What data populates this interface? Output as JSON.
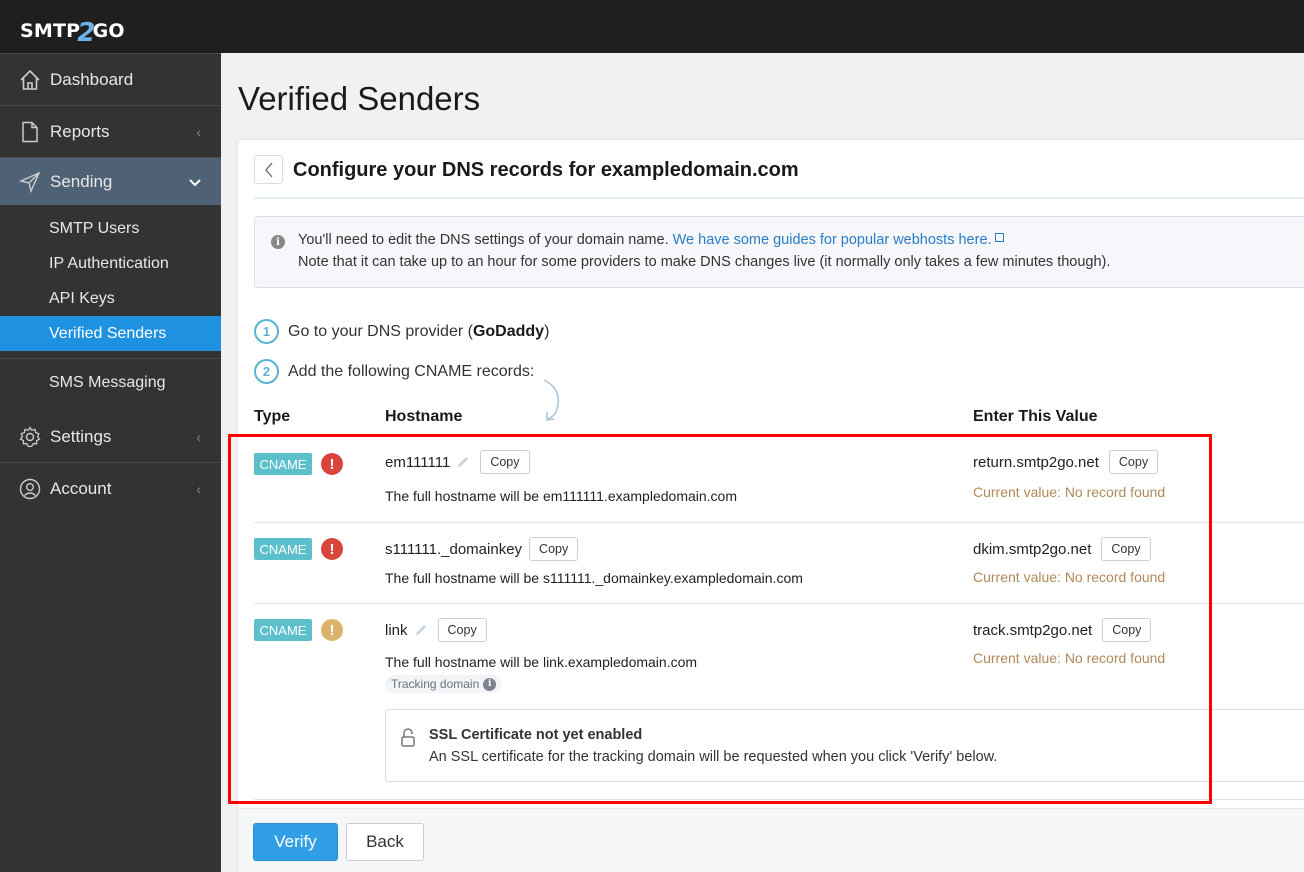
{
  "app": {
    "logo_left": "SMTP",
    "logo_mid": "2",
    "logo_right": "GO"
  },
  "sidebar": {
    "items": [
      {
        "label": "Dashboard",
        "icon": "home-icon"
      },
      {
        "label": "Reports",
        "icon": "file-icon",
        "chevron": "‹"
      },
      {
        "label": "Sending",
        "icon": "paper-plane-icon",
        "chevron": "⌄",
        "active": true
      }
    ],
    "sub_items": [
      {
        "label": "SMTP Users"
      },
      {
        "label": "IP Authentication"
      },
      {
        "label": "API Keys"
      },
      {
        "label": "Verified Senders",
        "selected": true
      },
      {
        "label": "SMS Messaging"
      }
    ],
    "bottom_items": [
      {
        "label": "Settings",
        "icon": "gear-icon",
        "chevron": "‹"
      },
      {
        "label": "Account",
        "icon": "user-circle-icon",
        "chevron": "‹"
      }
    ]
  },
  "page": {
    "title": "Verified Senders",
    "card_title": "Configure your DNS records for exampledomain.com",
    "back_glyph": "‹"
  },
  "info": {
    "icon_glyph": "i",
    "line1_text": "You'll need to edit the DNS settings of your domain name. ",
    "line1_link": "We have some guides for popular webhosts here.",
    "line2_text": "Note that it can take up to an hour for some providers to make DNS changes live (it normally only takes a few minutes though)."
  },
  "steps": [
    {
      "num": "1",
      "text_before": "Go to your DNS provider (",
      "bold": "GoDaddy",
      "text_after": ")"
    },
    {
      "num": "2",
      "text_before": "Add the following CNAME records:",
      "bold": "",
      "text_after": ""
    }
  ],
  "table": {
    "headers": {
      "type": "Type",
      "hostname": "Hostname",
      "value": "Enter This Value"
    },
    "rows": [
      {
        "type": "CNAME",
        "status": "error",
        "status_glyph": "!",
        "hostname": "em111111",
        "editable": true,
        "copy_label": "Copy",
        "full_hostname": "The full hostname will be em111111.exampledomain.com",
        "value": "return.smtp2go.net",
        "value_copy_label": "Copy",
        "current_value": "Current value: No record found"
      },
      {
        "type": "CNAME",
        "status": "error",
        "status_glyph": "!",
        "hostname": "s111111._domainkey",
        "editable": false,
        "copy_label": "Copy",
        "full_hostname": "The full hostname will be s111111._domainkey.exampledomain.com",
        "value": "dkim.smtp2go.net",
        "value_copy_label": "Copy",
        "current_value": "Current value: No record found"
      },
      {
        "type": "CNAME",
        "status": "warning",
        "status_glyph": "!",
        "hostname": "link",
        "editable": true,
        "copy_label": "Copy",
        "full_hostname": "The full hostname will be link.exampledomain.com",
        "tag": "Tracking domain",
        "tag_icon_glyph": "i",
        "value": "track.smtp2go.net",
        "value_copy_label": "Copy",
        "current_value": "Current value: No record found"
      }
    ]
  },
  "ssl": {
    "title": "SSL Certificate not yet enabled",
    "text": "An SSL certificate for the tracking domain will be requested when you click 'Verify' below."
  },
  "footer": {
    "verify_label": "Verify",
    "back_label": "Back"
  },
  "colors": {
    "accent": "#1e92e0",
    "badge": "#5bbfcc",
    "error": "#d9453b",
    "warning": "#dbb26a",
    "current_value": "#b08a5a",
    "highlight": "#ff0000"
  }
}
